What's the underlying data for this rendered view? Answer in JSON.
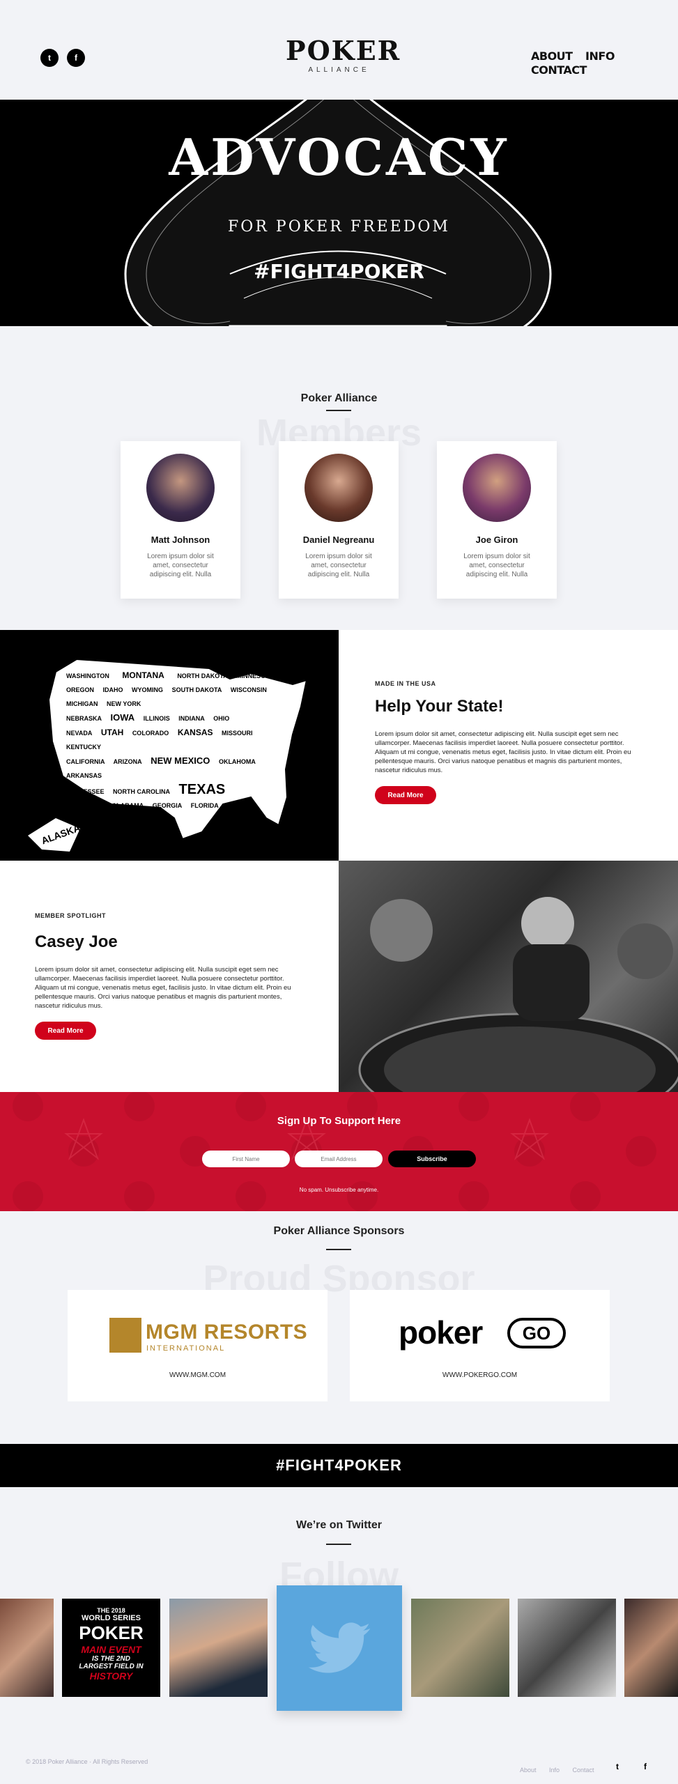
{
  "header": {
    "logo_word": "POKER",
    "logo_sub": "ALLIANCE",
    "social": [
      {
        "icon": "twitter-icon",
        "glyph": "t"
      },
      {
        "icon": "facebook-icon",
        "glyph": "f"
      }
    ],
    "nav": [
      "ABOUT",
      "INFO",
      "CONTACT"
    ]
  },
  "hero": {
    "title": "ADVOCACY",
    "subtitle": "FOR POKER FREEDOM",
    "tag": "#FIGHT4POKER"
  },
  "members": {
    "title": "Poker Alliance",
    "ghost": "Members",
    "cards": [
      {
        "name": "Matt Johnson",
        "desc": "Lorem ipsum dolor sit amet, consectetur adipiscing elit. Nulla"
      },
      {
        "name": "Daniel Negreanu",
        "desc": "Lorem ipsum dolor sit amet, consectetur adipiscing elit. Nulla"
      },
      {
        "name": "Joe Giron",
        "desc": "Lorem ipsum dolor sit amet, consectetur adipiscing elit. Nulla"
      }
    ]
  },
  "state": {
    "kicker": "MADE IN THE USA",
    "title": "Help Your State!",
    "body": "Lorem ipsum dolor sit amet, consectetur adipiscing elit. Nulla suscipit eget sem nec ullamcorper. Maecenas facilisis imperdiet laoreet. Nulla posuere consectetur porttitor. Aliquam ut mi congue, venenatis metus eget, facilisis justo. In vitae dictum elit. Proin eu pellentesque mauris. Orci varius natoque penatibus et magnis dis parturient montes, nascetur ridiculus mus.",
    "button": "Read More",
    "map_labels": [
      "WASHINGTON",
      "MONTANA",
      "NORTH DAKOTA",
      "MINNESOTA",
      "OREGON",
      "IDAHO",
      "WYOMING",
      "SOUTH DAKOTA",
      "WISCONSIN",
      "MICHIGAN",
      "NEW YORK",
      "NEBRASKA",
      "IOWA",
      "ILLINOIS",
      "INDIANA",
      "OHIO",
      "NEVADA",
      "UTAH",
      "COLORADO",
      "KANSAS",
      "MISSOURI",
      "KENTUCKY",
      "CALIFORNIA",
      "ARIZONA",
      "NEW MEXICO",
      "OKLAHOMA",
      "ARKANSAS",
      "TENNESSEE",
      "NORTH CAROLINA",
      "TEXAS",
      "MISSISSIPPI",
      "ALABAMA",
      "GEORGIA",
      "FLORIDA",
      "ALASKA"
    ]
  },
  "spotlight": {
    "kicker": "MEMBER SPOTLIGHT",
    "title": "Casey Joe",
    "body": "Lorem ipsum dolor sit amet, consectetur adipiscing elit. Nulla suscipit eget sem nec ullamcorper. Maecenas facilisis imperdiet laoreet. Nulla posuere consectetur porttitor. Aliquam ut mi congue, venenatis metus eget, facilisis justo. In vitae dictum elit. Proin eu pellentesque mauris. Orci varius natoque penatibus et magnis dis parturient montes, nascetur ridiculus mus.",
    "button": "Read More"
  },
  "signup": {
    "title": "Sign Up To Support Here",
    "first_name_placeholder": "First Name",
    "email_placeholder": "Email Address",
    "subscribe": "Subscribe",
    "note": "No spam. Unsubscribe anytime."
  },
  "sponsors": {
    "title": "Poker Alliance Sponsors",
    "ghost": "Proud Sponsor",
    "items": [
      {
        "name": "MGM RESORTS",
        "sub": "INTERNATIONAL",
        "url": "WWW.MGM.COM"
      },
      {
        "name": "poker",
        "name2": "GO",
        "url": "WWW.POKERGO.COM"
      }
    ]
  },
  "fight_banner": "#FIGHT4POKER",
  "twitter": {
    "title": "We’re on Twitter",
    "ghost": "Follow",
    "wsop": {
      "line1": "THE 2018",
      "line2": "WORLD SERIES",
      "line3": "POKER",
      "line4": "MAIN EVENT",
      "line5": "IS THE 2ND",
      "line6": "LARGEST FIELD IN",
      "line7": "HISTORY"
    }
  },
  "footer": {
    "copyright": "© 2018 Poker Alliance · All Rights Reserved",
    "links": [
      "About",
      "Info",
      "Contact"
    ]
  },
  "colors": {
    "accent": "#d0021b",
    "signup_bg": "#c8102e",
    "twitter": "#5aa6dd",
    "mgm_gold": "#b4862b"
  }
}
